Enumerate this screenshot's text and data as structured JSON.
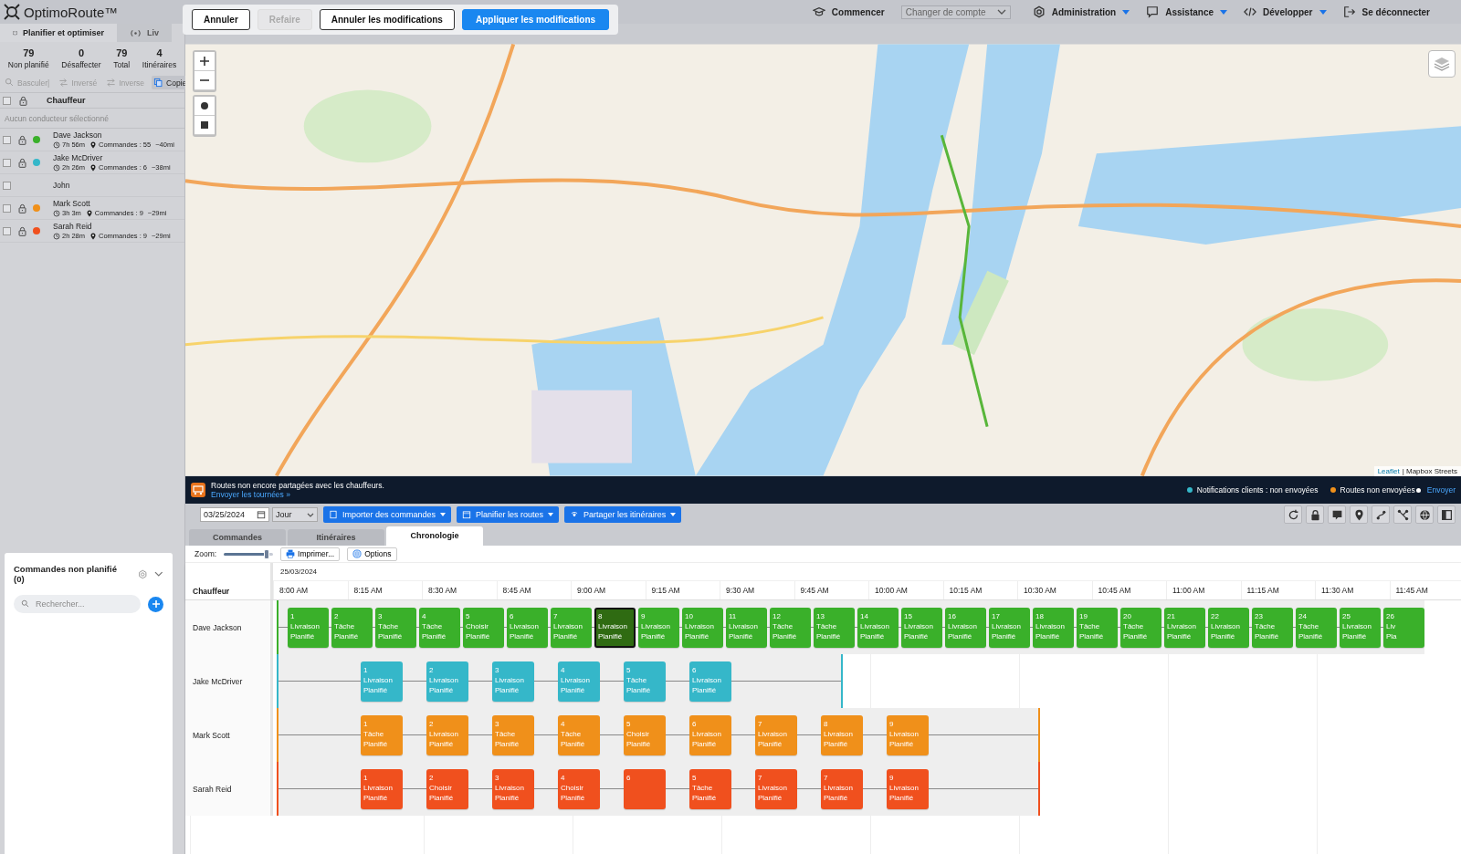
{
  "header": {
    "logo": "OptimoRoute™",
    "nav": [
      {
        "kind": "link",
        "label": "Commencer"
      },
      {
        "kind": "select",
        "label": "Changer de compte"
      },
      {
        "kind": "menu",
        "label": "Administration"
      },
      {
        "kind": "menu",
        "label": "Assistance"
      },
      {
        "kind": "menu",
        "label": "Développer"
      },
      {
        "kind": "link",
        "label": "Se déconnecter"
      }
    ]
  },
  "edit_toolbar": {
    "buttons": [
      {
        "label": "Annuler",
        "kind": "outline",
        "disabled": false
      },
      {
        "label": "Refaire",
        "kind": "outline",
        "disabled": true
      },
      {
        "label": "Annuler les modifications",
        "kind": "outline",
        "disabled": false
      },
      {
        "label": "Appliquer les modifications",
        "kind": "primary",
        "disabled": false
      }
    ]
  },
  "sidebar": {
    "tabs": [
      {
        "label": "Planifier et optimiser",
        "selected": true
      },
      {
        "label": "Liv",
        "selected": false
      }
    ],
    "stats": [
      {
        "value": "79",
        "label": "Non planifié"
      },
      {
        "value": "0",
        "label": "Désaffecter"
      },
      {
        "value": "79",
        "label": "Total"
      },
      {
        "value": "4",
        "label": "Itinéraires"
      }
    ],
    "actions": [
      {
        "label": "Basculer|",
        "selected": false
      },
      {
        "label": "Inversé",
        "selected": false
      },
      {
        "label": "Inverse",
        "selected": false
      },
      {
        "label": "Copie",
        "selected": true
      }
    ],
    "column": "Chauffeur",
    "all_checked": false,
    "empty_note": "Aucun conducteur sélectionné",
    "drivers": [
      {
        "name": "Dave Jackson",
        "color": "#3ab02a",
        "duration": "7h 56m",
        "orders": "Commandes : 55",
        "distance": "~40mi",
        "checked": false
      },
      {
        "name": "Jake McDriver",
        "color": "#35b7c9",
        "duration": "2h 26m",
        "orders": "Commandes : 6",
        "distance": "~38mi",
        "checked": false
      },
      {
        "name": "John",
        "checked": false
      },
      {
        "name": "Mark Scott",
        "color": "#f0901a",
        "duration": "3h 3m",
        "orders": "Commandes : 9",
        "distance": "~29mi",
        "checked": false
      },
      {
        "name": "Sarah Reid",
        "color": "#f0501e",
        "duration": "2h 28m",
        "orders": "Commandes : 9",
        "distance": "~29mi",
        "checked": false
      }
    ],
    "unplanned": {
      "title": "Commandes non planifié (0)",
      "placeholder": "Rechercher..."
    }
  },
  "map": {
    "attribution": [
      "Leaflet",
      "| Mapbox Streets"
    ]
  },
  "banner": {
    "message": "Routes non encore partagées avec les chauffeurs.",
    "link": "Envoyer les tournées »",
    "statuses": [
      {
        "label": "Notifications clients : non envoyées",
        "color": "#35b7c9"
      },
      {
        "label": "Routes non envoyées",
        "color": "#f0901a"
      }
    ],
    "action": "Envoyer"
  },
  "toolbar": {
    "date": "03/25/2024",
    "period": "Jour",
    "menus": [
      "Importer des commandes",
      "Planifier les routes",
      "Partager les itinéraires"
    ]
  },
  "tabs": [
    {
      "label": "Commandes",
      "selected": false
    },
    {
      "label": "Itinéraires",
      "selected": false
    },
    {
      "label": "Chronologie",
      "selected": true
    }
  ],
  "timeline": {
    "zoom_label": "Zoom:",
    "print": "Imprimer...",
    "options": "Options",
    "driver_column": "Chauffeur",
    "date": "25/03/2024",
    "times": [
      "8:00 AM",
      "8:15 AM",
      "8:30 AM",
      "8:45 AM",
      "9:00 AM",
      "9:15 AM",
      "9:30 AM",
      "9:45 AM",
      "10:00 AM",
      "10:15 AM",
      "10:30 AM",
      "10:45 AM",
      "11:00 AM",
      "11:15 AM",
      "11:30 AM",
      "11:45 AM"
    ],
    "rows": [
      {
        "driver": "Dave Jackson",
        "color": "#3ab02a",
        "dense": true,
        "blocks": [
          {
            "number": "1",
            "type": "Livraison",
            "status": "Planifié",
            "selected": false
          },
          {
            "number": "2",
            "type": "Tâche",
            "status": "Planifié",
            "selected": false
          },
          {
            "number": "3",
            "type": "Tâche",
            "status": "Planifié",
            "selected": false
          },
          {
            "number": "4",
            "type": "Tâche",
            "status": "Planifié",
            "selected": false
          },
          {
            "number": "5",
            "type": "Choisir",
            "status": "Planifié",
            "selected": false
          },
          {
            "number": "6",
            "type": "Livraison",
            "status": "Planifié",
            "selected": false
          },
          {
            "number": "7",
            "type": "Livraison",
            "status": "Planifié",
            "selected": false
          },
          {
            "number": "8",
            "type": "Livraison",
            "status": "Planifié",
            "selected": true
          },
          {
            "number": "9",
            "type": "Livraison",
            "status": "Planifié",
            "selected": false
          },
          {
            "number": "10",
            "type": "Livraison",
            "status": "Planifié",
            "selected": false
          },
          {
            "number": "11",
            "type": "Livraison",
            "status": "Planifié",
            "selected": false
          },
          {
            "number": "12",
            "type": "Tâche",
            "status": "Planifié",
            "selected": false
          },
          {
            "number": "13",
            "type": "Tâche",
            "status": "Planifié",
            "selected": false
          },
          {
            "number": "14",
            "type": "Livraison",
            "status": "Planifié",
            "selected": false
          },
          {
            "number": "15",
            "type": "Livraison",
            "status": "Planifié",
            "selected": false
          },
          {
            "number": "16",
            "type": "Livraison",
            "status": "Planifié",
            "selected": false
          },
          {
            "number": "17",
            "type": "Livraison",
            "status": "Planifié",
            "selected": false
          },
          {
            "number": "18",
            "type": "Livraison",
            "status": "Planifié",
            "selected": false
          },
          {
            "number": "19",
            "type": "Tâche",
            "status": "Planifié",
            "selected": false
          },
          {
            "number": "20",
            "type": "Tâche",
            "status": "Planifié",
            "selected": false
          },
          {
            "number": "21",
            "type": "Livraison",
            "status": "Planifié",
            "selected": false
          },
          {
            "number": "22",
            "type": "Livraison",
            "status": "Planifié",
            "selected": false
          },
          {
            "number": "23",
            "type": "Tâche",
            "status": "Planifié",
            "selected": false
          },
          {
            "number": "24",
            "type": "Tâche",
            "status": "Planifié",
            "selected": false
          },
          {
            "number": "25",
            "type": "Livraison",
            "status": "Planifié",
            "selected": false
          },
          {
            "number": "26",
            "type": "Liv",
            "status": "Pla",
            "selected": false
          }
        ]
      },
      {
        "driver": "Jake McDriver",
        "color": "#35b7c9",
        "dense": false,
        "blocks": [
          {
            "number": "1",
            "type": "Livraison",
            "status": "Planifié",
            "selected": false
          },
          {
            "number": "2",
            "type": "Livraison",
            "status": "Planifié",
            "selected": false
          },
          {
            "number": "3",
            "type": "Livraison",
            "status": "Planifié",
            "selected": false
          },
          {
            "number": "4",
            "type": "Livraison",
            "status": "Planifié",
            "selected": false
          },
          {
            "number": "5",
            "type": "Tâche",
            "status": "Planifié",
            "selected": false
          },
          {
            "number": "6",
            "type": "Livraison",
            "status": "Planifié",
            "selected": false
          }
        ]
      },
      {
        "driver": "Mark Scott",
        "color": "#f0901a",
        "dense": false,
        "blocks": [
          {
            "number": "1",
            "type": "Tâche",
            "status": "Planifié",
            "selected": false
          },
          {
            "number": "2",
            "type": "Livraison",
            "status": "Planifié",
            "selected": false
          },
          {
            "number": "3",
            "type": "Tâche",
            "status": "Planifié",
            "selected": false
          },
          {
            "number": "4",
            "type": "Tâche",
            "status": "Planifié",
            "selected": false
          },
          {
            "number": "5",
            "type": "Choisir",
            "status": "Planifié",
            "selected": false
          },
          {
            "number": "6",
            "type": "Livraison",
            "status": "Planifié",
            "selected": false
          },
          {
            "number": "7",
            "type": "Livraison",
            "status": "Planifié",
            "selected": false
          },
          {
            "number": "8",
            "type": "Livraison",
            "status": "Planifié",
            "selected": false
          },
          {
            "number": "9",
            "type": "Livraison",
            "status": "Planifié",
            "selected": false
          }
        ]
      },
      {
        "driver": "Sarah Reid",
        "color": "#f0501e",
        "dense": false,
        "blocks": [
          {
            "number": "1",
            "type": "Livraison",
            "status": "Planifié",
            "selected": false
          },
          {
            "number": "2",
            "type": "Choisir",
            "status": "Planifié",
            "selected": false
          },
          {
            "number": "3",
            "type": "Livraison",
            "status": "Planifié",
            "selected": false
          },
          {
            "number": "4",
            "type": "Choisir",
            "status": "Planifié",
            "selected": false
          },
          {
            "number": "6",
            "selected": false
          },
          {
            "number": "5",
            "type": "Tâche",
            "status": "Planifié",
            "selected": false
          },
          {
            "number": "7",
            "type": "Livraison",
            "status": "Planifié",
            "selected": false
          },
          {
            "number": "7",
            "type": "Livraison",
            "status": "Planifié",
            "selected": false
          },
          {
            "number": "9",
            "type": "Livraison",
            "status": "Planifié",
            "selected": false
          }
        ]
      }
    ]
  }
}
